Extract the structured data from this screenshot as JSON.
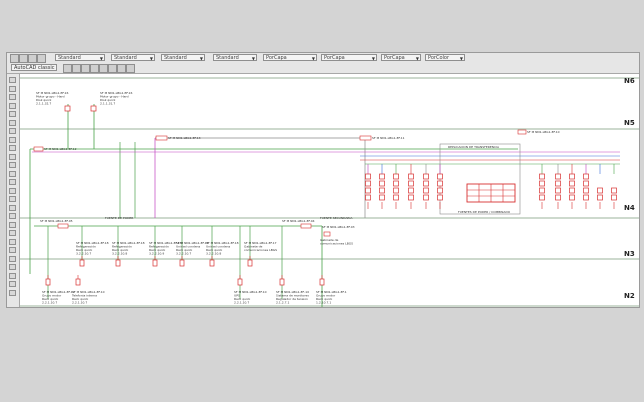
{
  "toolbar": {
    "style_dropdowns": [
      "Standard",
      "Standard",
      "Standard",
      "Standard"
    ],
    "layer_dropdown": "AutoCAD classic",
    "bycapa_dropdowns": [
      "PorCapa",
      "PorCapa",
      "PorCapa",
      "PorColor"
    ],
    "colors": {
      "bg": "#e6e6e6",
      "border": "#a8a8a8"
    }
  },
  "palette": {
    "tool_count": 26
  },
  "drawing": {
    "levels": [
      {
        "label": "N6"
      },
      {
        "label": "N5"
      },
      {
        "label": "N4"
      },
      {
        "label": "N3"
      },
      {
        "label": "N2"
      }
    ],
    "n5_boxes": [
      {
        "text": "SF M NN1-LBG1.EF.16\nMotor grupo - Hard\nDisk quick\n2.1.1.32.7"
      },
      {
        "text": "SF M NN1-LBG1.EF.16\nMotor grupo - Hard\nDisk quick\n2.1.1.31.7"
      }
    ],
    "n4_labels": {
      "box_a": "SF M NN1-LBG1-EF.13",
      "box_b": "SF M NN1-LBG1-EF.11",
      "box_c": "SF M NN1-LBG1-EF.12",
      "box_d": "SF M NN1-LBG1-EF.10",
      "transform_header": "REPLICACION DE TRANSFERENCIA",
      "transform_footer": "FUENTES DE PODER / COMBINADO"
    },
    "n3_labels": {
      "left_header": "FUENTE DE PODER",
      "right_header": "FUENTE SECUNDARIA",
      "box_l": "SF M NN1-LBG1-EF.05",
      "box_m": "SF M NN1-LBG1-EF.04",
      "box_r": "SF M NN1-LBG1-EF.03",
      "cabinet": "Gabinete de\ncomunicaciones LBGS"
    },
    "n3_devices": [
      {
        "text": "SF M NN1-LBG1-EF.18\nRefrigeración\nRack quick\n3.2.2.10.7"
      },
      {
        "text": "SF M NN1-LBG1-EF.18\nRefrigeración\nRack quick\n3.2.2.10.8"
      },
      {
        "text": "SF M NN1-LBG1-EF.18\nRefrigeración\nRack quick\n3.2.2.10.9"
      },
      {
        "text": "SF M NN1-LBG1-EF.18\nUnidad condens\nRack quick\n3.2.2.10.7"
      },
      {
        "text": "SF M NN1-LBG1-EF.18\nUnidad condens\nRack quick\n3.2.2.10.8"
      },
      {
        "text": "SF M NN1-LBG1-EF.17\nGabinete de\ncomunicaciones LBGS"
      }
    ],
    "n2_devices": [
      {
        "text": "SF M NN1-LBG1-EF.10\nGrupo motor\nRack quick\n2.2.1.10.7"
      },
      {
        "text": "SF M NN1-LBG1-EF.10\nTelefonia interna\nRack quick\n2.2.1.10.7"
      },
      {
        "text": "SF M NN1-LBG1-EF.10\nUPS\nRack quick\n2.2.1.10.7"
      },
      {
        "text": "SF M NN1-LBG1-EF-10\nSistema de monitoreo\nRegulador de tension\n2.1.2.7.1"
      },
      {
        "text": "SF M NN1-LBG1-EF.1\nGrupo motor\nRack quick\n1.2.10.7.1"
      }
    ],
    "colors": {
      "line_green": "#4aa34a",
      "line_red": "#d83030",
      "line_blue": "#3a6fd8",
      "line_magenta": "#c040c0",
      "line_gray": "#8a8a8a",
      "level_line": "#7a9a7a"
    }
  }
}
